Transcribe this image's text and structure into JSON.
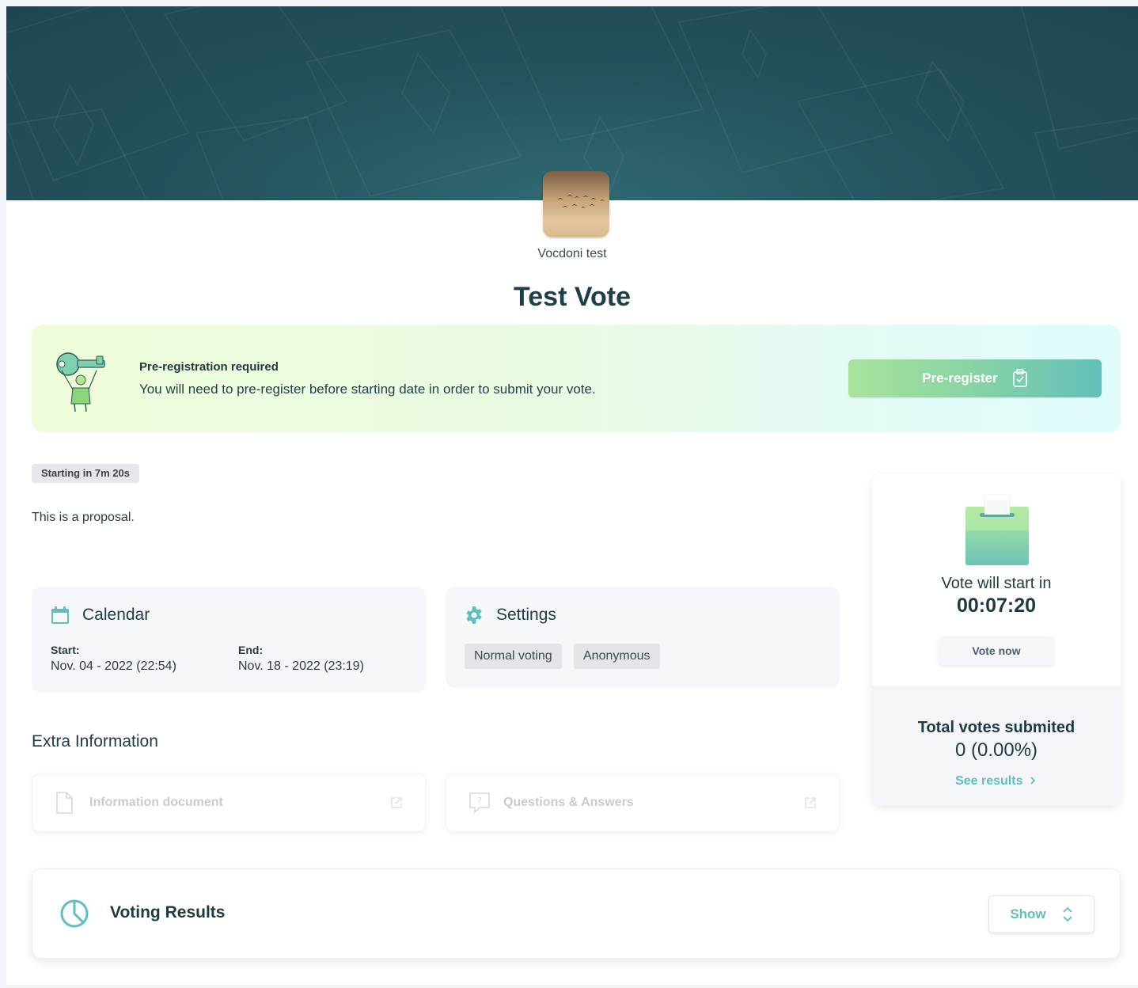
{
  "organization": {
    "name": "Vocdoni test"
  },
  "process": {
    "title": "Test Vote"
  },
  "prereg": {
    "title": "Pre-registration required",
    "text": "You will need to pre-register before starting date in order to submit your vote.",
    "button_label": "Pre-register"
  },
  "status_badge": "Starting in 7m 20s",
  "proposal": "This is a proposal.",
  "calendar": {
    "title": "Calendar",
    "start_label": "Start:",
    "start_value": "Nov. 04 - 2022 (22:54)",
    "end_label": "End:",
    "end_value": "Nov. 18 - 2022 (23:19)"
  },
  "settings": {
    "title": "Settings",
    "tags": [
      "Normal voting",
      "Anonymous"
    ]
  },
  "extra": {
    "title": "Extra Information",
    "info_document": "Information document",
    "qa": "Questions & Answers"
  },
  "sidebar": {
    "start_text": "Vote will start in",
    "countdown": "00:07:20",
    "vote_button": "Vote now",
    "total_title": "Total votes submited",
    "total_value": "0 (0.00%)",
    "see_results": "See results"
  },
  "results": {
    "title": "Voting Results",
    "show_button": "Show"
  },
  "colors": {
    "banner": "#24525d",
    "accent": "#5fbfbb",
    "prereg_button_start": "#a8e39c",
    "prereg_button_end": "#62bfb9"
  },
  "icons": {
    "calendar": "calendar-icon",
    "settings": "gear-icon",
    "document": "document-icon",
    "qa": "question-bubble-icon",
    "external": "external-link-icon",
    "results": "clock-pie-icon",
    "ballot": "ballot-box-icon",
    "clipboard": "clipboard-check-icon"
  }
}
